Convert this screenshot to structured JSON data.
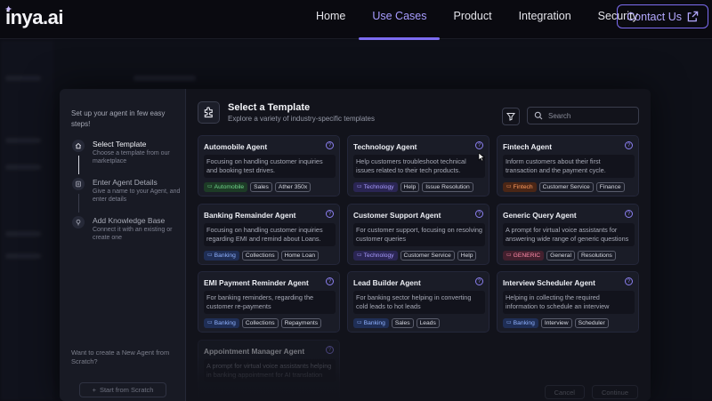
{
  "nav": {
    "logo": "inya.ai",
    "links": [
      {
        "label": "Home",
        "active": false
      },
      {
        "label": "Use Cases",
        "active": true
      },
      {
        "label": "Product",
        "active": false
      },
      {
        "label": "Integration",
        "active": false
      },
      {
        "label": "Security",
        "active": false
      }
    ],
    "contact_label": "Contact Us"
  },
  "sidebar": {
    "intro": "Set up your agent in few easy steps!",
    "steps": [
      {
        "title": "Select Template",
        "desc": "Choose a template from our marketplace",
        "icon": "home-icon",
        "active": true
      },
      {
        "title": "Enter Agent Details",
        "desc": "Give a name to your Agent, and enter details",
        "icon": "document-icon",
        "active": false
      },
      {
        "title": "Add Knowledge Base",
        "desc": "Connect it with an existing or create one",
        "icon": "bulb-icon",
        "active": false
      }
    ],
    "scratch_question": "Want to create a New Agent from Scratch?",
    "scratch_button": "Start from Scratch"
  },
  "header": {
    "title": "Select a Template",
    "subtitle": "Explore a variety of industry-specific templates",
    "search_placeholder": "Search"
  },
  "templates": [
    {
      "title": "Automobile Agent",
      "desc": "Focusing on handling customer inquiries and booking test drives.",
      "category": "Automobile",
      "cat_color": "green",
      "tags": [
        "Sales",
        "Ather 350x"
      ]
    },
    {
      "title": "Technology Agent",
      "desc": "Help customers troubleshoot technical issues related to their tech products.",
      "category": "Technology",
      "cat_color": "purple",
      "tags": [
        "Help",
        "Issue Resolution"
      ]
    },
    {
      "title": "Fintech Agent",
      "desc": "Inform customers about their first transaction and the payment cycle.",
      "category": "Fintech",
      "cat_color": "orange",
      "tags": [
        "Customer Service",
        "Finance"
      ]
    },
    {
      "title": "Banking Remainder Agent",
      "desc": "Focusing on handling customer inquiries regarding EMI and remind about Loans.",
      "category": "Banking",
      "cat_color": "blue",
      "tags": [
        "Collections",
        "Home Loan"
      ]
    },
    {
      "title": "Customer Support Agent",
      "desc": "For customer support, focusing on resolving customer queries",
      "category": "Technology",
      "cat_color": "purple",
      "tags": [
        "Customer Service",
        "Help"
      ]
    },
    {
      "title": "Generic Query Agent",
      "desc": "A prompt for virtual voice assistants for answering wide range of generic questions",
      "category": "GENERIC",
      "cat_color": "red",
      "tags": [
        "General",
        "Resolutions"
      ]
    },
    {
      "title": "EMI Payment Reminder Agent",
      "desc": "For banking reminders, regarding the customer re-payments",
      "category": "Banking",
      "cat_color": "blue",
      "tags": [
        "Collections",
        "Repayments"
      ]
    },
    {
      "title": "Lead Builder Agent",
      "desc": "For banking sector helping in converting cold leads to hot leads",
      "category": "Banking",
      "cat_color": "blue",
      "tags": [
        "Sales",
        "Leads"
      ]
    },
    {
      "title": "Interview Scheduler Agent",
      "desc": "Helping in collecting the required information to schedule an interview",
      "category": "Banking",
      "cat_color": "blue",
      "tags": [
        "Interview",
        "Scheduler"
      ]
    },
    {
      "title": "Appointment Manager Agent",
      "desc": "A prompt for virtual voice assistants helping in banking appointment for AI translation",
      "category": "",
      "cat_color": "blue",
      "tags": []
    }
  ],
  "footer": {
    "cancel_label": "Cancel",
    "next_label": "Continue"
  },
  "colors": {
    "accent": "#7c6cf0",
    "background": "#0c0d15"
  }
}
